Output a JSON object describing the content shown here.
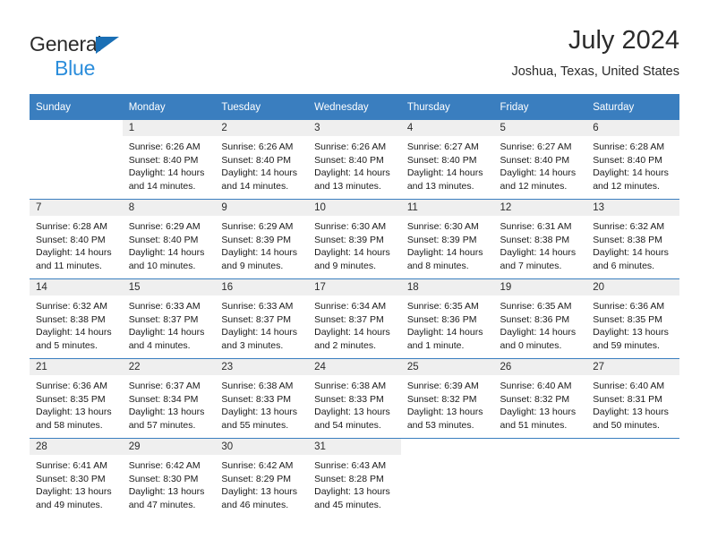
{
  "brand": {
    "name_part1": "General",
    "name_part2": "Blue",
    "accent_color": "#2b8ddb",
    "triangle_color": "#1a6fb5"
  },
  "header": {
    "title": "July 2024",
    "subtitle": "Joshua, Texas, United States"
  },
  "calendar": {
    "header_bg": "#3a7ebf",
    "daynum_bg": "#efefef",
    "weekdays": [
      "Sunday",
      "Monday",
      "Tuesday",
      "Wednesday",
      "Thursday",
      "Friday",
      "Saturday"
    ],
    "weeks": [
      [
        {
          "day": "",
          "sunrise": "",
          "sunset": "",
          "daylight1": "",
          "daylight2": ""
        },
        {
          "day": "1",
          "sunrise": "Sunrise: 6:26 AM",
          "sunset": "Sunset: 8:40 PM",
          "daylight1": "Daylight: 14 hours",
          "daylight2": "and 14 minutes."
        },
        {
          "day": "2",
          "sunrise": "Sunrise: 6:26 AM",
          "sunset": "Sunset: 8:40 PM",
          "daylight1": "Daylight: 14 hours",
          "daylight2": "and 14 minutes."
        },
        {
          "day": "3",
          "sunrise": "Sunrise: 6:26 AM",
          "sunset": "Sunset: 8:40 PM",
          "daylight1": "Daylight: 14 hours",
          "daylight2": "and 13 minutes."
        },
        {
          "day": "4",
          "sunrise": "Sunrise: 6:27 AM",
          "sunset": "Sunset: 8:40 PM",
          "daylight1": "Daylight: 14 hours",
          "daylight2": "and 13 minutes."
        },
        {
          "day": "5",
          "sunrise": "Sunrise: 6:27 AM",
          "sunset": "Sunset: 8:40 PM",
          "daylight1": "Daylight: 14 hours",
          "daylight2": "and 12 minutes."
        },
        {
          "day": "6",
          "sunrise": "Sunrise: 6:28 AM",
          "sunset": "Sunset: 8:40 PM",
          "daylight1": "Daylight: 14 hours",
          "daylight2": "and 12 minutes."
        }
      ],
      [
        {
          "day": "7",
          "sunrise": "Sunrise: 6:28 AM",
          "sunset": "Sunset: 8:40 PM",
          "daylight1": "Daylight: 14 hours",
          "daylight2": "and 11 minutes."
        },
        {
          "day": "8",
          "sunrise": "Sunrise: 6:29 AM",
          "sunset": "Sunset: 8:40 PM",
          "daylight1": "Daylight: 14 hours",
          "daylight2": "and 10 minutes."
        },
        {
          "day": "9",
          "sunrise": "Sunrise: 6:29 AM",
          "sunset": "Sunset: 8:39 PM",
          "daylight1": "Daylight: 14 hours",
          "daylight2": "and 9 minutes."
        },
        {
          "day": "10",
          "sunrise": "Sunrise: 6:30 AM",
          "sunset": "Sunset: 8:39 PM",
          "daylight1": "Daylight: 14 hours",
          "daylight2": "and 9 minutes."
        },
        {
          "day": "11",
          "sunrise": "Sunrise: 6:30 AM",
          "sunset": "Sunset: 8:39 PM",
          "daylight1": "Daylight: 14 hours",
          "daylight2": "and 8 minutes."
        },
        {
          "day": "12",
          "sunrise": "Sunrise: 6:31 AM",
          "sunset": "Sunset: 8:38 PM",
          "daylight1": "Daylight: 14 hours",
          "daylight2": "and 7 minutes."
        },
        {
          "day": "13",
          "sunrise": "Sunrise: 6:32 AM",
          "sunset": "Sunset: 8:38 PM",
          "daylight1": "Daylight: 14 hours",
          "daylight2": "and 6 minutes."
        }
      ],
      [
        {
          "day": "14",
          "sunrise": "Sunrise: 6:32 AM",
          "sunset": "Sunset: 8:38 PM",
          "daylight1": "Daylight: 14 hours",
          "daylight2": "and 5 minutes."
        },
        {
          "day": "15",
          "sunrise": "Sunrise: 6:33 AM",
          "sunset": "Sunset: 8:37 PM",
          "daylight1": "Daylight: 14 hours",
          "daylight2": "and 4 minutes."
        },
        {
          "day": "16",
          "sunrise": "Sunrise: 6:33 AM",
          "sunset": "Sunset: 8:37 PM",
          "daylight1": "Daylight: 14 hours",
          "daylight2": "and 3 minutes."
        },
        {
          "day": "17",
          "sunrise": "Sunrise: 6:34 AM",
          "sunset": "Sunset: 8:37 PM",
          "daylight1": "Daylight: 14 hours",
          "daylight2": "and 2 minutes."
        },
        {
          "day": "18",
          "sunrise": "Sunrise: 6:35 AM",
          "sunset": "Sunset: 8:36 PM",
          "daylight1": "Daylight: 14 hours",
          "daylight2": "and 1 minute."
        },
        {
          "day": "19",
          "sunrise": "Sunrise: 6:35 AM",
          "sunset": "Sunset: 8:36 PM",
          "daylight1": "Daylight: 14 hours",
          "daylight2": "and 0 minutes."
        },
        {
          "day": "20",
          "sunrise": "Sunrise: 6:36 AM",
          "sunset": "Sunset: 8:35 PM",
          "daylight1": "Daylight: 13 hours",
          "daylight2": "and 59 minutes."
        }
      ],
      [
        {
          "day": "21",
          "sunrise": "Sunrise: 6:36 AM",
          "sunset": "Sunset: 8:35 PM",
          "daylight1": "Daylight: 13 hours",
          "daylight2": "and 58 minutes."
        },
        {
          "day": "22",
          "sunrise": "Sunrise: 6:37 AM",
          "sunset": "Sunset: 8:34 PM",
          "daylight1": "Daylight: 13 hours",
          "daylight2": "and 57 minutes."
        },
        {
          "day": "23",
          "sunrise": "Sunrise: 6:38 AM",
          "sunset": "Sunset: 8:33 PM",
          "daylight1": "Daylight: 13 hours",
          "daylight2": "and 55 minutes."
        },
        {
          "day": "24",
          "sunrise": "Sunrise: 6:38 AM",
          "sunset": "Sunset: 8:33 PM",
          "daylight1": "Daylight: 13 hours",
          "daylight2": "and 54 minutes."
        },
        {
          "day": "25",
          "sunrise": "Sunrise: 6:39 AM",
          "sunset": "Sunset: 8:32 PM",
          "daylight1": "Daylight: 13 hours",
          "daylight2": "and 53 minutes."
        },
        {
          "day": "26",
          "sunrise": "Sunrise: 6:40 AM",
          "sunset": "Sunset: 8:32 PM",
          "daylight1": "Daylight: 13 hours",
          "daylight2": "and 51 minutes."
        },
        {
          "day": "27",
          "sunrise": "Sunrise: 6:40 AM",
          "sunset": "Sunset: 8:31 PM",
          "daylight1": "Daylight: 13 hours",
          "daylight2": "and 50 minutes."
        }
      ],
      [
        {
          "day": "28",
          "sunrise": "Sunrise: 6:41 AM",
          "sunset": "Sunset: 8:30 PM",
          "daylight1": "Daylight: 13 hours",
          "daylight2": "and 49 minutes."
        },
        {
          "day": "29",
          "sunrise": "Sunrise: 6:42 AM",
          "sunset": "Sunset: 8:30 PM",
          "daylight1": "Daylight: 13 hours",
          "daylight2": "and 47 minutes."
        },
        {
          "day": "30",
          "sunrise": "Sunrise: 6:42 AM",
          "sunset": "Sunset: 8:29 PM",
          "daylight1": "Daylight: 13 hours",
          "daylight2": "and 46 minutes."
        },
        {
          "day": "31",
          "sunrise": "Sunrise: 6:43 AM",
          "sunset": "Sunset: 8:28 PM",
          "daylight1": "Daylight: 13 hours",
          "daylight2": "and 45 minutes."
        },
        {
          "day": "",
          "sunrise": "",
          "sunset": "",
          "daylight1": "",
          "daylight2": ""
        },
        {
          "day": "",
          "sunrise": "",
          "sunset": "",
          "daylight1": "",
          "daylight2": ""
        },
        {
          "day": "",
          "sunrise": "",
          "sunset": "",
          "daylight1": "",
          "daylight2": ""
        }
      ]
    ]
  }
}
